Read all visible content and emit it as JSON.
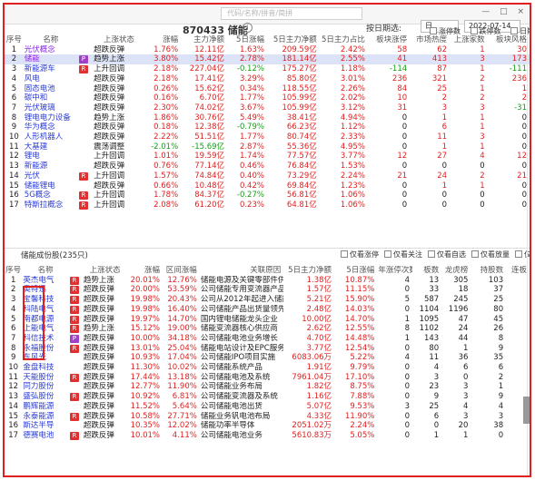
{
  "toolbar": {
    "search_placeholder": "代码/名称/拼音/简拼",
    "window_controls": [
      "—",
      "□",
      "×"
    ]
  },
  "board": {
    "title": "870433 储能",
    "info_icon": "i",
    "date_label": "按日期选:",
    "date_select": "日",
    "date_value": "2022-07-14",
    "checks": [
      "涨停数",
      "跌停数",
      "日期"
    ]
  },
  "top_table": {
    "headers": [
      "序号",
      "名称",
      "",
      "上涨状态",
      "涨幅",
      "主力净额",
      "5日涨幅",
      "5日主力净额",
      "5日主力占比",
      "板块涨停",
      "市场热度",
      "上涨家数",
      "板块风格"
    ],
    "rows": [
      [
        "1",
        "光伏概念",
        "",
        "超跌反弹",
        "1.76%",
        "12.11亿",
        "1.63%",
        "209.59亿",
        "2.42%",
        "58",
        "62",
        "1",
        "30"
      ],
      [
        "2",
        "储能",
        "P",
        "趋势上涨",
        "3.80%",
        "15.42亿",
        "2.78%",
        "181.14亿",
        "2.55%",
        "41",
        "413",
        "3",
        "173"
      ],
      [
        "3",
        "新能源车",
        "R",
        "上升回调",
        "2.18%",
        "227.04亿",
        "-0.12%",
        "175.27亿",
        "1.18%",
        "-114",
        "87",
        "1",
        "-111"
      ],
      [
        "4",
        "风电",
        "",
        "超跌反弹",
        "2.18%",
        "17.41亿",
        "3.29%",
        "85.80亿",
        "3.01%",
        "236",
        "321",
        "2",
        "236"
      ],
      [
        "5",
        "固态电池",
        "",
        "超跌反弹",
        "0.26%",
        "15.62亿",
        "0.34%",
        "118.55亿",
        "2.26%",
        "84",
        "25",
        "1",
        "1"
      ],
      [
        "6",
        "碳中和",
        "",
        "超跌反弹",
        "0.16%",
        "6.70亿",
        "1.77%",
        "105.99亿",
        "2.02%",
        "10",
        "2",
        "2",
        "2"
      ],
      [
        "7",
        "光伏玻璃",
        "",
        "超跌反弹",
        "2.30%",
        "74.02亿",
        "3.67%",
        "105.99亿",
        "3.12%",
        "31",
        "3",
        "3",
        "-31"
      ],
      [
        "8",
        "锂电电力设备",
        "",
        "趋势上涨",
        "1.86%",
        "30.76亿",
        "5.49%",
        "38.41亿",
        "4.94%",
        "0",
        "1",
        "1",
        "0"
      ],
      [
        "9",
        "华为概念",
        "",
        "超跌反弹",
        "0.18%",
        "12.38亿",
        "-0.79%",
        "66.23亿",
        "1.12%",
        "0",
        "6",
        "1",
        "0"
      ],
      [
        "10",
        "人形机器人",
        "",
        "超跌反弹",
        "2.22%",
        "51.51亿",
        "1.77%",
        "80.74亿",
        "2.33%",
        "0",
        "11",
        "3",
        "0"
      ],
      [
        "11",
        "大基建",
        "",
        "震荡调整",
        "-2.01%",
        "-15.69亿",
        "2.87%",
        "55.36亿",
        "4.95%",
        "0",
        "1",
        "1",
        "0"
      ],
      [
        "12",
        "锂电",
        "",
        "上升回调",
        "1.01%",
        "19.59亿",
        "1.74%",
        "77.57亿",
        "3.77%",
        "12",
        "27",
        "4",
        "12"
      ],
      [
        "13",
        "新能源",
        "",
        "超跌反弹",
        "0.76%",
        "77.14亿",
        "0.46%",
        "76.84亿",
        "1.53%",
        "0",
        "0",
        "0",
        "0"
      ],
      [
        "14",
        "光伏",
        "R",
        "上升回调",
        "1.57%",
        "74.84亿",
        "0.40%",
        "73.29亿",
        "2.24%",
        "21",
        "24",
        "2",
        "21"
      ],
      [
        "15",
        "储能锂电",
        "",
        "超跌反弹",
        "0.66%",
        "10.48亿",
        "0.42%",
        "69.84亿",
        "1.23%",
        "0",
        "1",
        "1",
        "0"
      ],
      [
        "16",
        "5G概念",
        "R",
        "上升回调",
        "1.78%",
        "84.37亿",
        "-0.27%",
        "56.81亿",
        "1.06%",
        "0",
        "0",
        "0",
        "0"
      ],
      [
        "17",
        "特斯拉概念",
        "R",
        "上升回调",
        "2.08%",
        "61.20亿",
        "0.23%",
        "64.81亿",
        "1.06%",
        "0",
        "0",
        "0",
        "0"
      ]
    ]
  },
  "bottom_bar": {
    "title": "储能成份股(235只)",
    "checks": [
      "仅看涨停",
      "仅看关注",
      "仅看自选",
      "仅看放量",
      "仅看新高"
    ]
  },
  "bottom_table": {
    "headers": [
      "序号",
      "名称",
      "",
      "上涨状态",
      "涨幅",
      "区间涨幅",
      "关联原因",
      "5日主力净额",
      "5日涨幅",
      "年涨停次数",
      "板数",
      "龙虎榜",
      "持股数",
      "连板"
    ],
    "rows": [
      [
        "1",
        "英杰电气",
        "R",
        "趋势上涨",
        "20.01%",
        "12.76%",
        "储能电源及关键零部件供应",
        "1.38亿",
        "10.87%",
        "4",
        "13",
        "305",
        "103"
      ],
      [
        "2",
        "奥特迅",
        "R",
        "超跌反弹",
        "20.00%",
        "53.59%",
        "公司储能专用变流器产品",
        "1.57亿",
        "11.15%",
        "0",
        "33",
        "18",
        "37"
      ],
      [
        "3",
        "宝馨科技",
        "R",
        "超跌反弹",
        "19.98%",
        "20.43%",
        "公司从2012年起进入储能",
        "5.21亿",
        "15.90%",
        "5",
        "587",
        "245",
        "25"
      ],
      [
        "4",
        "科陆电气",
        "R",
        "超跌反弹",
        "19.98%",
        "16.40%",
        "公司储能产品出货量领先",
        "2.48亿",
        "14.03%",
        "0",
        "1104",
        "1196",
        "80"
      ],
      [
        "5",
        "南都电源",
        "R",
        "超跌反弹",
        "19.97%",
        "14.70%",
        "国内锂电储能龙头企业",
        "10.00亿",
        "14.70%",
        "1",
        "1095",
        "47",
        "45"
      ],
      [
        "6",
        "上能电气",
        "R",
        "趋势上涨",
        "15.12%",
        "19.00%",
        "储能变流器核心供应商",
        "2.62亿",
        "12.55%",
        "8",
        "1102",
        "24",
        "26"
      ],
      [
        "7",
        "科信技术",
        "P",
        "超跌反弹",
        "10.00%",
        "34.18%",
        "公司储能电池业务增长",
        "4.70亿",
        "14.48%",
        "1",
        "143",
        "44",
        "8"
      ],
      [
        "8",
        "永福股份",
        "R",
        "超跌反弹",
        "13.01%",
        "25.04%",
        "储能电站设计及EPC服务",
        "3.77亿",
        "12.54%",
        "0",
        "80",
        "1",
        "9"
      ],
      [
        "9",
        "东风光",
        "",
        "超跌反弹",
        "10.93%",
        "17.04%",
        "公司储能IPO项目实施",
        "6083.06万",
        "5.22%",
        "4",
        "11",
        "36",
        "35"
      ],
      [
        "10",
        "金盘科技",
        "",
        "超跌反弹",
        "11.30%",
        "10.02%",
        "公司储能系统产品",
        "1.91亿",
        "9.79%",
        "0",
        "4",
        "6",
        "6"
      ],
      [
        "11",
        "天能股份",
        "R",
        "超跌反弹",
        "17.44%",
        "13.18%",
        "公司储能电池及系统",
        "7961.04万",
        "17.10%",
        "0",
        "3",
        "0",
        "2"
      ],
      [
        "12",
        "同力股份",
        "",
        "超跌反弹",
        "12.77%",
        "11.90%",
        "公司储能业务布局",
        "1.82亿",
        "8.75%",
        "0",
        "23",
        "3",
        "1"
      ],
      [
        "13",
        "盛弘股份",
        "R",
        "超跌反弹",
        "10.92%",
        "6.81%",
        "公司储能变流器及系统",
        "1.16亿",
        "7.88%",
        "0",
        "9",
        "3",
        "9"
      ],
      [
        "14",
        "鹏辉能源",
        "",
        "超跌反弹",
        "11.52%",
        "5.64%",
        "公司储能电池出货",
        "5.07亿",
        "9.53%",
        "3",
        "25",
        "4",
        "4"
      ],
      [
        "15",
        "永泰能源",
        "R",
        "超跌反弹",
        "10.58%",
        "27.71%",
        "储能业务钒电池布局",
        "4.33亿",
        "11.90%",
        "0",
        "6",
        "3",
        "3"
      ],
      [
        "16",
        "斯达半导",
        "",
        "超跌反弹",
        "10.35%",
        "12.02%",
        "储能功率半导体",
        "2051.02万",
        "2.24%",
        "0",
        "0",
        "20",
        "38"
      ],
      [
        "17",
        "德赛电池",
        "R",
        "超跌反弹",
        "10.01%",
        "4.11%",
        "公司储能电池业务",
        "5610.83万",
        "5.05%",
        "0",
        "1",
        "1",
        "0"
      ]
    ]
  },
  "colors": {
    "frame": "#e02020",
    "up": "#e02020",
    "down": "#12a012",
    "highlight_row": "#dde3f7"
  }
}
